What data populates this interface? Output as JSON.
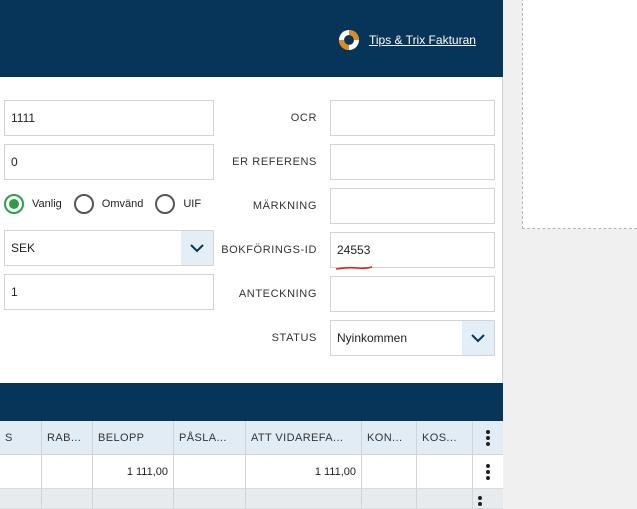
{
  "header": {
    "tips_label": "Tips & Trix Fakturan"
  },
  "left_fields": {
    "field1_value": "1111",
    "field2_value": "0",
    "currency_value": "SEK",
    "field5_value": "1"
  },
  "vat_type": {
    "options": [
      "Vanlig",
      "Omvänd",
      "UIF"
    ],
    "selected": "Vanlig"
  },
  "right_fields": {
    "ocr_label": "OCR",
    "ocr_value": "",
    "er_referens_label": "ER REFERENS",
    "er_referens_value": "",
    "markning_label": "MÄRKNING",
    "markning_value": "",
    "bokforings_label": "BOKFÖRINGS-ID",
    "bokforings_value": "24553",
    "anteckning_label": "ANTECKNING",
    "anteckning_value": "",
    "status_label": "STATUS",
    "status_value": "Nyinkommen"
  },
  "table": {
    "columns": [
      "S",
      "RAB...",
      "BELOPP",
      "PÅSLA...",
      "ATT VIDAREFA...",
      "KON...",
      "KOS..."
    ],
    "row1": [
      "",
      "",
      "1 111,00",
      "",
      "1 111,00",
      "",
      ""
    ]
  },
  "colors": {
    "header_bg": "#063559",
    "accent_green": "#2e9d47",
    "annotation_red": "#e02020"
  }
}
